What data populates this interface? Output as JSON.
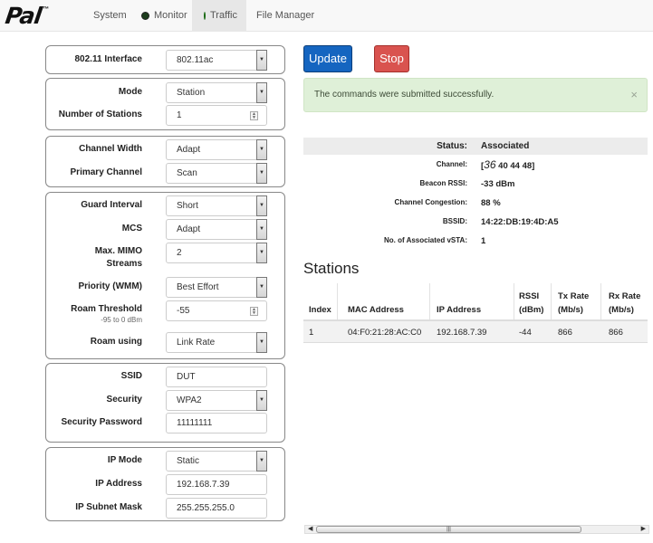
{
  "nav": {
    "logo_text": "Pal",
    "logo_tm": "™",
    "items": [
      {
        "label": "System",
        "status": null
      },
      {
        "label": "Monitor",
        "status": "inactive"
      },
      {
        "label": "Traffic",
        "status": "active"
      },
      {
        "label": "File Manager",
        "status": null
      }
    ],
    "active_tab": "Traffic"
  },
  "form": {
    "interface": {
      "label": "802.11 Interface",
      "value": "802.11ac"
    },
    "mode": {
      "label": "Mode",
      "value": "Station"
    },
    "num_stations": {
      "label": "Number of Stations",
      "value": "1"
    },
    "channel_width": {
      "label": "Channel Width",
      "value": "Adapt"
    },
    "primary_channel": {
      "label": "Primary Channel",
      "value": "Scan"
    },
    "guard_interval": {
      "label": "Guard Interval",
      "value": "Short"
    },
    "mcs": {
      "label": "MCS",
      "value": "Adapt"
    },
    "mimo": {
      "label_line1": "Max. MIMO",
      "label_line2": "Streams",
      "value": "2"
    },
    "priority": {
      "label": "Priority (WMM)",
      "value": "Best Effort"
    },
    "roam_threshold": {
      "label": "Roam Threshold",
      "hint": "-95 to 0 dBm",
      "value": "-55"
    },
    "roam_using": {
      "label": "Roam using",
      "value": "Link Rate"
    },
    "ssid": {
      "label": "SSID",
      "value": "DUT"
    },
    "security": {
      "label": "Security",
      "value": "WPA2"
    },
    "password": {
      "label": "Security Password",
      "value": "11111111"
    },
    "ip_mode": {
      "label": "IP Mode",
      "value": "Static"
    },
    "ip_address": {
      "label": "IP Address",
      "value": "192.168.7.39"
    },
    "subnet": {
      "label": "IP Subnet Mask",
      "value": "255.255.255.0"
    }
  },
  "actions": {
    "update_label": "Update",
    "stop_label": "Stop",
    "update_color": "#1565c0",
    "stop_color": "#d9534f"
  },
  "alert": {
    "message": "The commands were submitted successfully.",
    "close": "×"
  },
  "status": {
    "status_key": "Status:",
    "status_val": "Associated",
    "channel_key": "Channel:",
    "channel_open": "[",
    "channel_primary": "36",
    "channel_rest": " 40 44 48]",
    "rssi_key": "Beacon RSSI:",
    "rssi_val": "-33 dBm",
    "congestion_key": "Channel Congestion:",
    "congestion_val": "88 %",
    "bssid_key": "BSSID:",
    "bssid_val": "14:22:DB:19:4D:A5",
    "vsta_key": "No. of Associated vSTA:",
    "vsta_val": "1"
  },
  "stations": {
    "title": "Stations",
    "headers": {
      "index": "Index",
      "mac": "MAC Address",
      "ip": "IP Address",
      "rssi_1": "RSSI",
      "rssi_2": "(dBm)",
      "tx_1": "Tx Rate",
      "tx_2": "(Mb/s)",
      "rx_1": "Rx Rate",
      "rx_2": "(Mb/s)"
    },
    "rows": [
      {
        "index": "1",
        "mac": "04:F0:21:28:AC:C0",
        "ip": "192.168.7.39",
        "rssi": "-44",
        "tx": "866",
        "rx": "866"
      }
    ]
  }
}
